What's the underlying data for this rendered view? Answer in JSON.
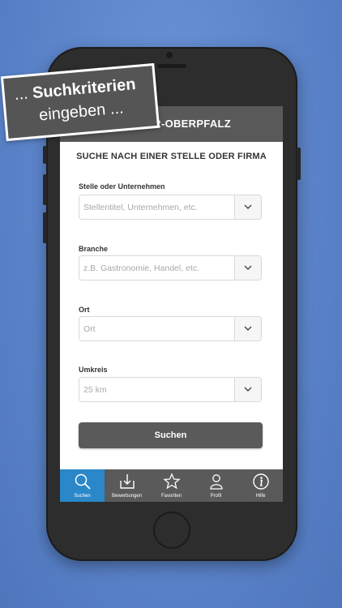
{
  "promo": {
    "line1_prefix": "... ",
    "line1_bold": "Suchkriterien",
    "line2": "eingeben ..."
  },
  "header": {
    "title": "R-OBERPFALZ"
  },
  "form": {
    "title": "SUCHE NACH EINER STELLE ODER FIRMA",
    "fields": [
      {
        "label": "Stelle oder Unternehmen",
        "placeholder": "Stellentitel, Unternehmen, etc."
      },
      {
        "label": "Branche",
        "placeholder": "z.B. Gastronomie, Handel, etc."
      },
      {
        "label": "Ort",
        "placeholder": "Ort"
      },
      {
        "label": "Umkreis",
        "value": "25 km"
      }
    ],
    "submit_label": "Suchen"
  },
  "tabbar": {
    "items": [
      {
        "label": "Suchen",
        "icon": "search-icon",
        "active": true
      },
      {
        "label": "Bewerbungen",
        "icon": "download-icon",
        "active": false
      },
      {
        "label": "Favoriten",
        "icon": "star-icon",
        "active": false
      },
      {
        "label": "Profil",
        "icon": "user-icon",
        "active": false
      },
      {
        "label": "Hilfe",
        "icon": "info-icon",
        "active": false
      }
    ]
  },
  "colors": {
    "background": "#5a82c8",
    "header": "#595959",
    "button": "#5a5a5a",
    "active_tab": "#2a88c8"
  }
}
